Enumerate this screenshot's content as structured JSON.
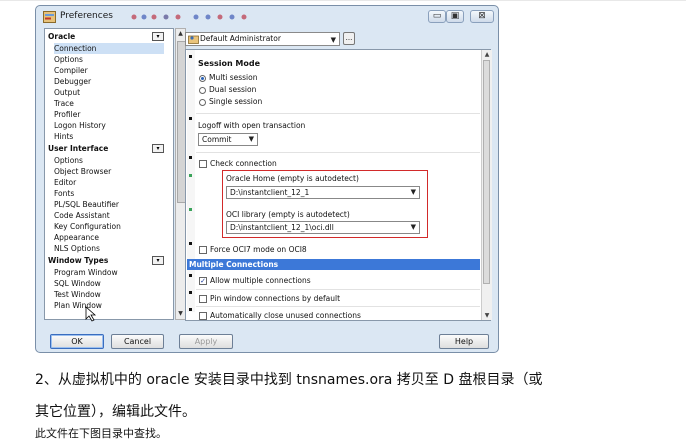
{
  "window": {
    "title": "Preferences",
    "controls": {
      "minimize": "▭",
      "maximize": "▣",
      "close": "⊠"
    }
  },
  "profile_selector": {
    "value": "Default Administrator",
    "more_label": "..."
  },
  "tree": {
    "groups": [
      {
        "label": "Oracle",
        "items": [
          "Connection",
          "Options",
          "Compiler",
          "Debugger",
          "Output",
          "Trace",
          "Profiler",
          "Logon History",
          "Hints"
        ]
      },
      {
        "label": "User Interface",
        "items": [
          "Options",
          "Object Browser",
          "Editor",
          "Fonts",
          "PL/SQL Beautifier",
          "Code Assistant",
          "Key Configuration",
          "Appearance",
          "NLS Options"
        ]
      },
      {
        "label": "Window Types",
        "items": [
          "Program Window",
          "SQL Window",
          "Test Window",
          "Plan Window"
        ]
      }
    ],
    "selected": "Connection"
  },
  "settings": {
    "session_mode": {
      "title": "Session Mode",
      "options": [
        "Multi session",
        "Dual session",
        "Single session"
      ],
      "selected": "Multi session"
    },
    "logoff": {
      "title": "Logoff with open transaction",
      "value": "Commit"
    },
    "check_connection": {
      "label": "Check connection",
      "checked": false
    },
    "oracle_home": {
      "label": "Oracle Home (empty is autodetect)",
      "value": "D:\\instantclient_12_1"
    },
    "oci_library": {
      "label": "OCI library (empty is autodetect)",
      "value": "D:\\instantclient_12_1\\oci.dll"
    },
    "force_oci7": {
      "label": "Force OCI7 mode on OCI8",
      "checked": false
    },
    "multiple_connections": {
      "title": "Multiple Connections",
      "allow": {
        "label": "Allow multiple connections",
        "checked": true
      },
      "pin": {
        "label": "Pin window connections by default",
        "checked": false
      },
      "auto_close": {
        "label": "Automatically close unused connections",
        "checked": false
      }
    }
  },
  "buttons": {
    "ok": "OK",
    "cancel": "Cancel",
    "apply": "Apply",
    "help": "Help"
  },
  "doc_text": {
    "line1": "2、从虚拟机中的 oracle 安装目录中找到 tnsnames.ora 拷贝至 D 盘根目录（或",
    "line2": "其它位置），编辑此文件。",
    "line3": "此文件在下图目录中查找。"
  },
  "colors": {
    "accent": "#3c78d8",
    "highlight_box": "#d22a2a",
    "window_bg": "#dbe7f3"
  }
}
